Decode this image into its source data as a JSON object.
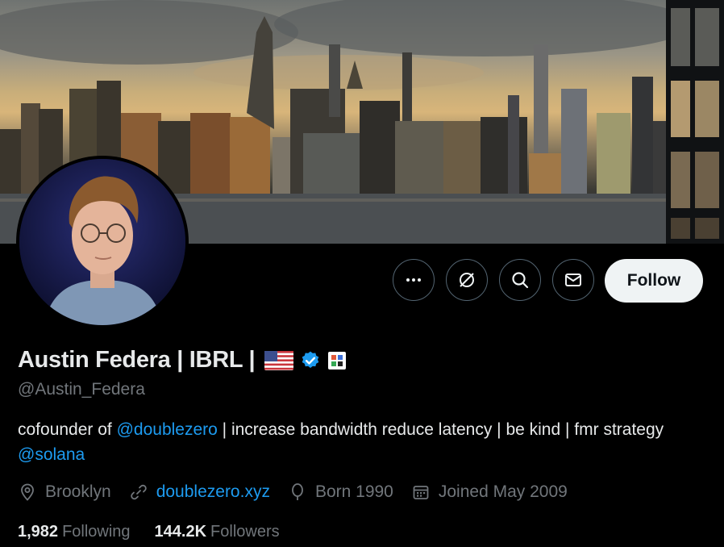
{
  "profile": {
    "display_name": "Austin Federa | IBRL |",
    "handle": "@Austin_Federa",
    "verified": true,
    "bio": {
      "prefix": "cofounder of ",
      "mention1": "@doublezero",
      "middle": " | increase bandwidth reduce latency | be kind | fmr strategy ",
      "mention2": "@solana"
    },
    "location": "Brooklyn",
    "website": "doublezero.xyz",
    "born": "Born 1990",
    "joined": "Joined May 2009",
    "following_count": "1,982",
    "following_label": "Following",
    "followers_count": "144.2K",
    "followers_label": "Followers"
  },
  "actions": {
    "more_icon": "more-icon",
    "grok_icon": "grok-icon",
    "search_icon": "search-icon",
    "message_icon": "envelope-icon",
    "follow_label": "Follow"
  },
  "colors": {
    "background": "#000000",
    "link": "#1d9bf0",
    "verified_badge": "#1d9bf0",
    "secondary_text": "#71767b",
    "follow_button_bg": "#eff3f4"
  }
}
